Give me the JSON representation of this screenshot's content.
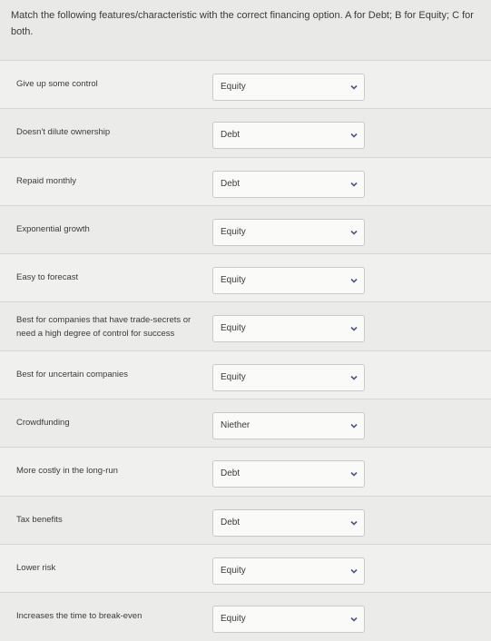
{
  "instructions": "Match the following features/characteristic with the correct financing option. A for Debt; B for Equity; C for both.",
  "rows": [
    {
      "label": "Give up some control",
      "value": "Equity"
    },
    {
      "label": "Doesn't dilute ownership",
      "value": "Debt"
    },
    {
      "label": "Repaid monthly",
      "value": "Debt"
    },
    {
      "label": "Exponential growth",
      "value": "Equity"
    },
    {
      "label": "Easy to forecast",
      "value": "Equity"
    },
    {
      "label": "Best for companies that have trade-secrets or need a high degree of control for success",
      "value": "Equity"
    },
    {
      "label": "Best for uncertain companies",
      "value": "Equity"
    },
    {
      "label": "Crowdfunding",
      "value": "Niether"
    },
    {
      "label": "More costly in the long-run",
      "value": "Debt"
    },
    {
      "label": "Tax benefits",
      "value": "Debt"
    },
    {
      "label": "Lower risk",
      "value": "Equity"
    },
    {
      "label": "Increases the time to break-even",
      "value": "Equity"
    }
  ],
  "icons": {
    "dropdown": "chevron-down-icon"
  },
  "colors": {
    "background": "#e9e9e7",
    "select_bg": "#fafaf8",
    "border": "#c9c9c6",
    "chevron": "#4a5a8a"
  }
}
